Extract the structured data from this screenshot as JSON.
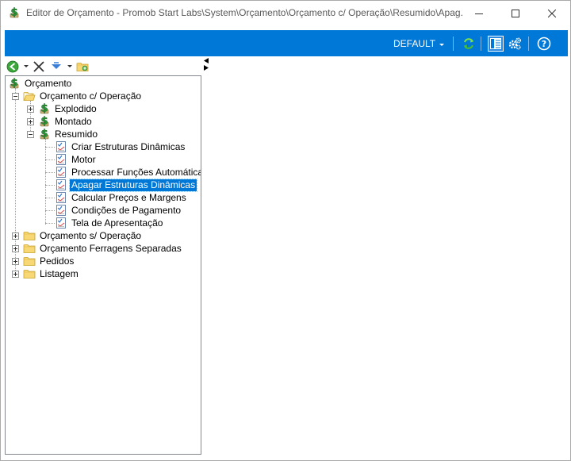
{
  "window": {
    "title": "Editor de Orçamento - Promob Start Labs\\System\\Orçamento\\Orçamento c/ Operação\\Resumido\\Apag...",
    "app_icon": "budget-dollar-icon"
  },
  "toolbar": {
    "profile_label": "DEFAULT",
    "icons": [
      "refresh-icon",
      "panel-layout-icon",
      "settings-gears-icon",
      "help-icon"
    ]
  },
  "tree_toolbar": {
    "icons": [
      "back-green-icon",
      "delete-x-icon",
      "move-down-icon",
      "add-folder-icon"
    ]
  },
  "tree": {
    "root": "Orçamento",
    "com_operacao": "Orçamento c/ Operação",
    "explodido": "Explodido",
    "montado": "Montado",
    "resumido": "Resumido",
    "items": [
      "Criar Estruturas Dinâmicas",
      "Motor",
      "Processar Funções Automáticas",
      "Apagar Estruturas Dinâmicas",
      "Calcular Preços e Margens",
      "Condições de Pagamento",
      "Tela de Apresentação"
    ],
    "selected_item": "Apagar Estruturas Dinâmicas",
    "sem_operacao": "Orçamento s/ Operação",
    "ferragens": "Orçamento Ferragens Separadas",
    "pedidos": "Pedidos",
    "listagem": "Listagem"
  },
  "colors": {
    "accent": "#0078d7",
    "selection": "#0078d7",
    "folder": "#f5c842",
    "dollar_green": "#2e9a3a"
  }
}
